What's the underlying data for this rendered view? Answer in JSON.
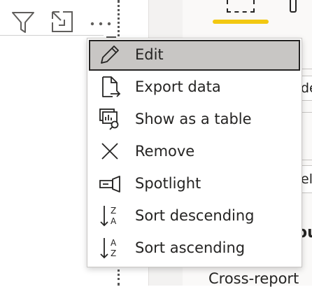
{
  "visual_header": {
    "icons": [
      "filter-icon",
      "focus-mode-icon",
      "more-options-icon"
    ]
  },
  "context_menu": {
    "items": [
      {
        "label": "Edit",
        "icon": "pencil-icon",
        "selected": true
      },
      {
        "label": "Export data",
        "icon": "export-data-icon"
      },
      {
        "label": "Show as a table",
        "icon": "show-as-table-icon"
      },
      {
        "label": "Remove",
        "icon": "close-icon"
      },
      {
        "label": "Spotlight",
        "icon": "spotlight-icon"
      },
      {
        "label": "Sort descending",
        "icon": "sort-descending-icon"
      },
      {
        "label": "Sort ascending",
        "icon": "sort-ascending-icon"
      }
    ]
  },
  "right_pane": {
    "field_1_partial": "de",
    "field_2_partial": "el",
    "heading_partial": "ou",
    "cross_report_label": "Cross-report"
  },
  "colors": {
    "selected_background": "#c8c6c4",
    "accent_underline": "#f2c811",
    "text": "#252423"
  }
}
